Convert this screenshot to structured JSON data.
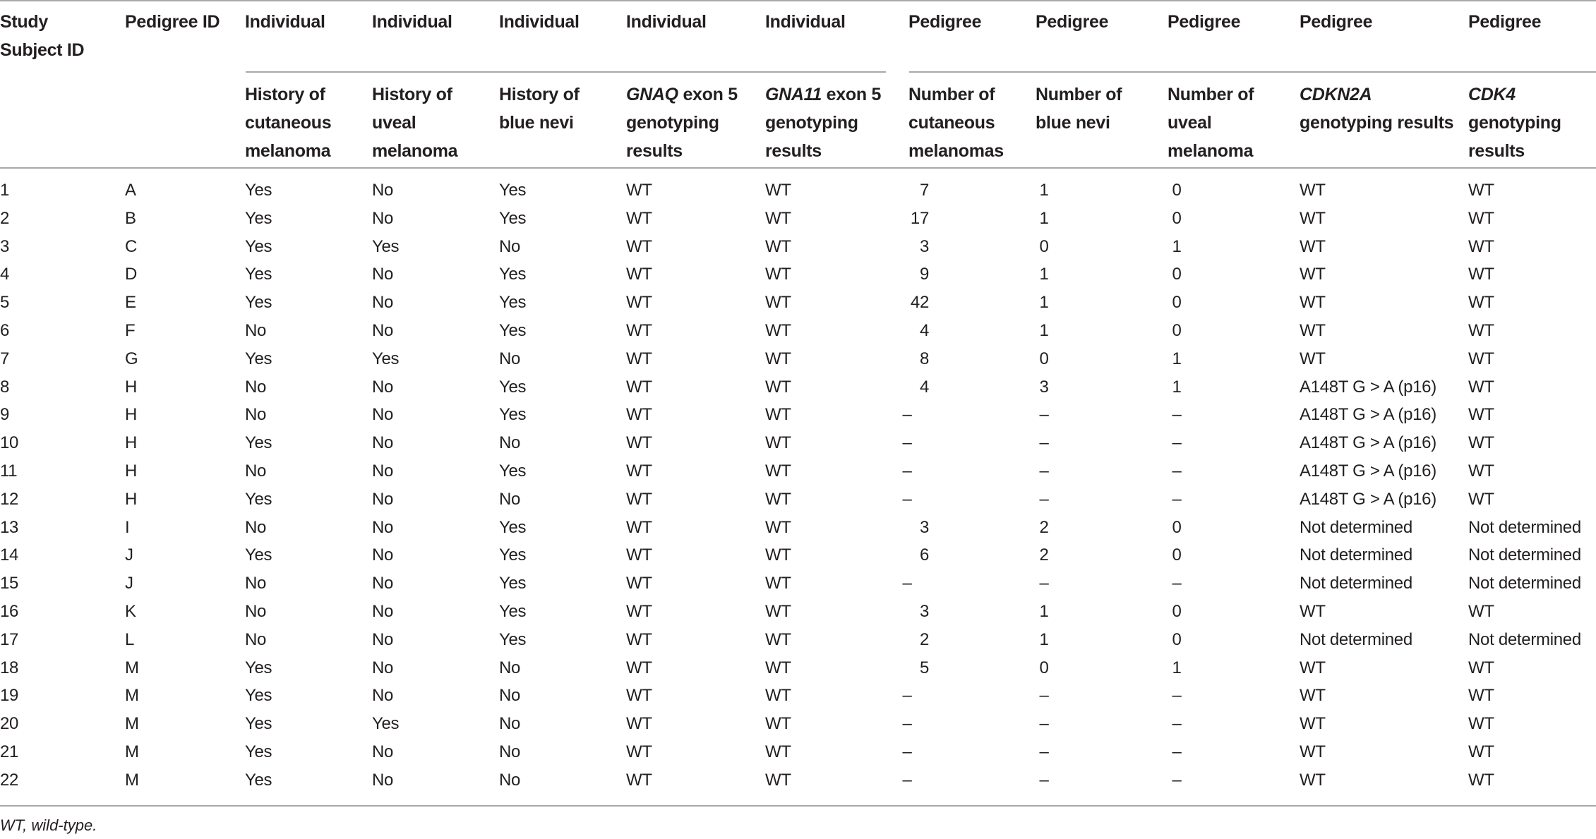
{
  "table": {
    "group_headers": [
      "",
      "",
      "Individual",
      "Individual",
      "Individual",
      "Individual",
      "Individual",
      "Pedigree",
      "Pedigree",
      "Pedigree",
      "Pedigree",
      "Pedigree"
    ],
    "id_headers": {
      "study_subject_id": "Study Subject ID",
      "pedigree_id": "Pedigree ID"
    },
    "sub_headers": [
      {
        "italic": "",
        "text": "History of cutaneous melanoma"
      },
      {
        "italic": "",
        "text": "History of uveal melanoma"
      },
      {
        "italic": "",
        "text": "History of blue nevi"
      },
      {
        "italic": "GNAQ",
        "text": " exon 5 genotyping results"
      },
      {
        "italic": "GNA11",
        "text": " exon 5 genotyping results"
      },
      {
        "italic": "",
        "text": "Number of cutaneous melanomas"
      },
      {
        "italic": "",
        "text": "Number of blue nevi"
      },
      {
        "italic": "",
        "text": "Number of uveal melanoma"
      },
      {
        "italic": "CDKN2A",
        "text": " genotyping results"
      },
      {
        "italic": "CDK4",
        "text": " genotyping results"
      }
    ],
    "rows": [
      [
        "1",
        "A",
        "Yes",
        "No",
        "Yes",
        "WT",
        "WT",
        "7",
        "1",
        "0",
        "WT",
        "WT"
      ],
      [
        "2",
        "B",
        "Yes",
        "No",
        "Yes",
        "WT",
        "WT",
        "17",
        "1",
        "0",
        "WT",
        "WT"
      ],
      [
        "3",
        "C",
        "Yes",
        "Yes",
        "No",
        "WT",
        "WT",
        "3",
        "0",
        "1",
        "WT",
        "WT"
      ],
      [
        "4",
        "D",
        "Yes",
        "No",
        "Yes",
        "WT",
        "WT",
        "9",
        "1",
        "0",
        "WT",
        "WT"
      ],
      [
        "5",
        "E",
        "Yes",
        "No",
        "Yes",
        "WT",
        "WT",
        "42",
        "1",
        "0",
        "WT",
        "WT"
      ],
      [
        "6",
        "F",
        "No",
        "No",
        "Yes",
        "WT",
        "WT",
        "4",
        "1",
        "0",
        "WT",
        "WT"
      ],
      [
        "7",
        "G",
        "Yes",
        "Yes",
        "No",
        "WT",
        "WT",
        "8",
        "0",
        "1",
        "WT",
        "WT"
      ],
      [
        "8",
        "H",
        "No",
        "No",
        "Yes",
        "WT",
        "WT",
        "4",
        "3",
        "1",
        "A148T G > A (p16)",
        "WT"
      ],
      [
        "9",
        "H",
        "No",
        "No",
        "Yes",
        "WT",
        "WT",
        "–",
        "–",
        "–",
        "A148T G > A (p16)",
        "WT"
      ],
      [
        "10",
        "H",
        "Yes",
        "No",
        "No",
        "WT",
        "WT",
        "–",
        "–",
        "–",
        "A148T G > A (p16)",
        "WT"
      ],
      [
        "11",
        "H",
        "No",
        "No",
        "Yes",
        "WT",
        "WT",
        "–",
        "–",
        "–",
        "A148T G > A (p16)",
        "WT"
      ],
      [
        "12",
        "H",
        "Yes",
        "No",
        "No",
        "WT",
        "WT",
        "–",
        "–",
        "–",
        "A148T G > A (p16)",
        "WT"
      ],
      [
        "13",
        "I",
        "No",
        "No",
        "Yes",
        "WT",
        "WT",
        "3",
        "2",
        "0",
        "Not determined",
        "Not determined"
      ],
      [
        "14",
        "J",
        "Yes",
        "No",
        "Yes",
        "WT",
        "WT",
        "6",
        "2",
        "0",
        "Not determined",
        "Not determined"
      ],
      [
        "15",
        "J",
        "No",
        "No",
        "Yes",
        "WT",
        "WT",
        "–",
        "–",
        "–",
        "Not determined",
        "Not determined"
      ],
      [
        "16",
        "K",
        "No",
        "No",
        "Yes",
        "WT",
        "WT",
        "3",
        "1",
        "0",
        "WT",
        "WT"
      ],
      [
        "17",
        "L",
        "No",
        "No",
        "Yes",
        "WT",
        "WT",
        "2",
        "1",
        "0",
        "Not determined",
        "Not determined"
      ],
      [
        "18",
        "M",
        "Yes",
        "No",
        "No",
        "WT",
        "WT",
        "5",
        "0",
        "1",
        "WT",
        "WT"
      ],
      [
        "19",
        "M",
        "Yes",
        "No",
        "No",
        "WT",
        "WT",
        "–",
        "–",
        "–",
        "WT",
        "WT"
      ],
      [
        "20",
        "M",
        "Yes",
        "Yes",
        "No",
        "WT",
        "WT",
        "–",
        "–",
        "–",
        "WT",
        "WT"
      ],
      [
        "21",
        "M",
        "Yes",
        "No",
        "No",
        "WT",
        "WT",
        "–",
        "–",
        "–",
        "WT",
        "WT"
      ],
      [
        "22",
        "M",
        "Yes",
        "No",
        "No",
        "WT",
        "WT",
        "–",
        "–",
        "–",
        "WT",
        "WT"
      ]
    ],
    "footnote": "WT, wild-type."
  }
}
